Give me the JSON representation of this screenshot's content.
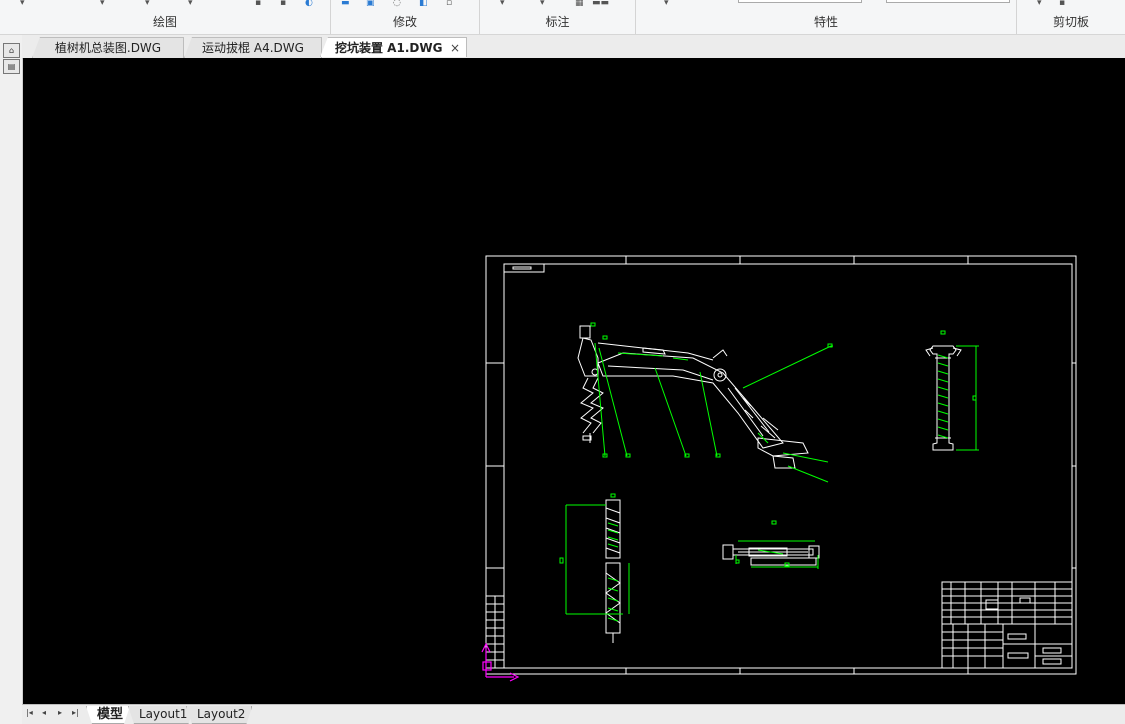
{
  "ribbon": {
    "groups": [
      {
        "label": "绘图"
      },
      {
        "label": "修改"
      },
      {
        "label": "标注"
      },
      {
        "label": "特性"
      },
      {
        "label": "剪切板"
      }
    ]
  },
  "doc_tabs": [
    {
      "label": "植树机总装图.DWG",
      "active": false
    },
    {
      "label": "运动拔棍 A4.DWG",
      "active": false
    },
    {
      "label": "挖坑装置 A1.DWG",
      "active": true
    }
  ],
  "close_glyph": "×",
  "layout_tabs": [
    {
      "label": "模型",
      "active": true
    },
    {
      "label": "Layout1",
      "active": false
    },
    {
      "label": "Layout2",
      "active": false
    }
  ],
  "colors": {
    "canvas": "#000000",
    "geometry": "#ffffff",
    "annotation": "#00ff00",
    "ucs": "#ff00ff"
  }
}
